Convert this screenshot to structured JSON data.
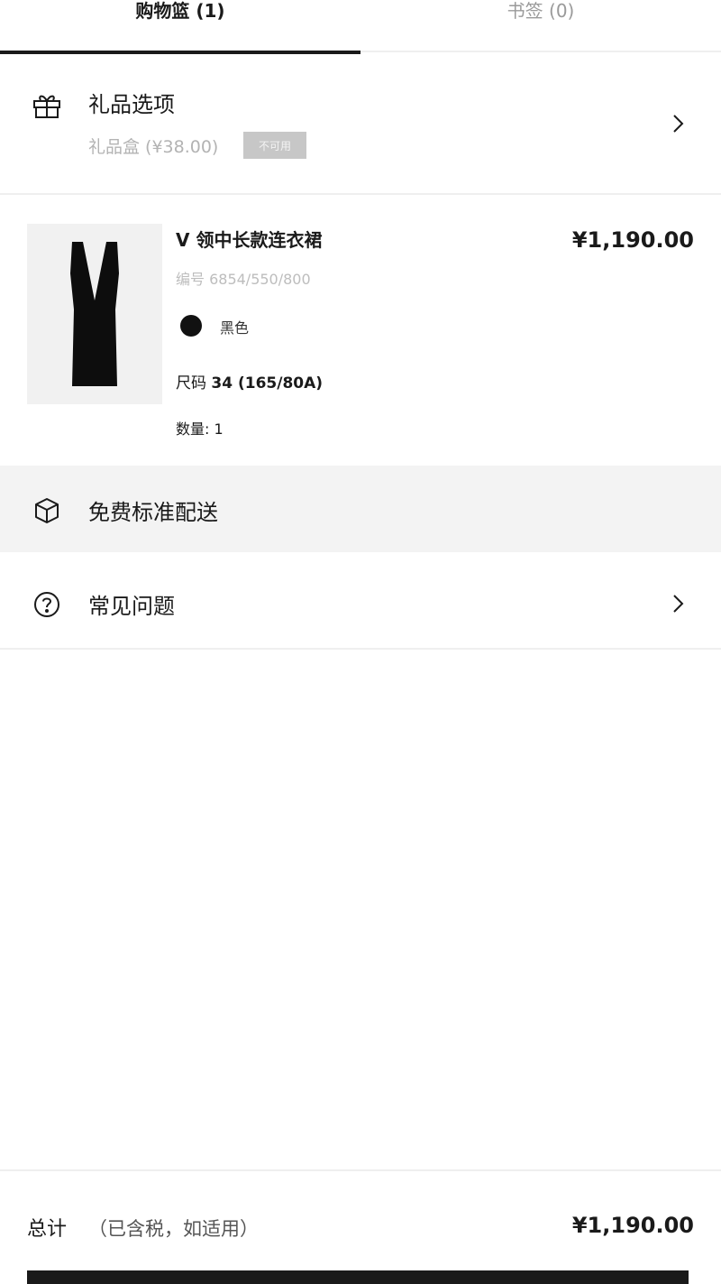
{
  "tabs": [
    {
      "label": "购物篮 (1)",
      "active": true
    },
    {
      "label": "书签 (0)",
      "active": false
    }
  ],
  "gift": {
    "title": "礼品选项",
    "subtitle": "礼品盒 (¥38.00)",
    "badge": "不可用",
    "icon": "gift-icon"
  },
  "product": {
    "name": "V 领中长款连衣裙",
    "price": "¥1,190.00",
    "ref_label": "编号 6854/550/800",
    "color_name": "黑色",
    "color_hex": "#111111",
    "size_prefix": "尺码",
    "size_value": "34 (165/80A)",
    "quantity": "数量: 1",
    "image": "black-v-neck-dress"
  },
  "shipping": {
    "text": "免费标准配送",
    "icon": "box-icon"
  },
  "faq": {
    "text": "常见问题",
    "icon": "question-icon"
  },
  "footer": {
    "total_label": "总计",
    "total_note": "（已含税，如适用）",
    "total_price": "¥1,190.00"
  },
  "colors": {
    "accent": "#1a1a1a",
    "muted": "#b3b3b3",
    "divider": "#efefef",
    "shipping_bg": "#f3f3f3"
  }
}
